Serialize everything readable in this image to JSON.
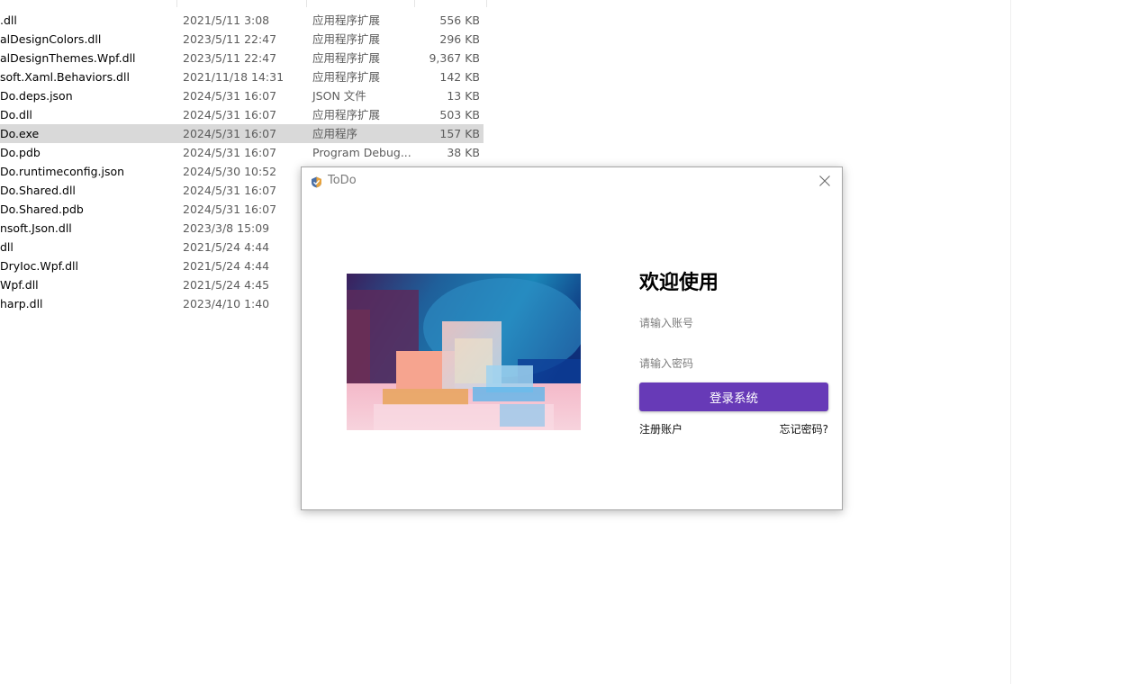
{
  "explorer": {
    "files": [
      {
        "name": ".dll",
        "date": "2021/5/11 3:08",
        "type": "应用程序扩展",
        "size": "556 KB"
      },
      {
        "name": "alDesignColors.dll",
        "date": "2023/5/11 22:47",
        "type": "应用程序扩展",
        "size": "296 KB"
      },
      {
        "name": "alDesignThemes.Wpf.dll",
        "date": "2023/5/11 22:47",
        "type": "应用程序扩展",
        "size": "9,367 KB"
      },
      {
        "name": "soft.Xaml.Behaviors.dll",
        "date": "2021/11/18 14:31",
        "type": "应用程序扩展",
        "size": "142 KB"
      },
      {
        "name": "Do.deps.json",
        "date": "2024/5/31 16:07",
        "type": "JSON 文件",
        "size": "13 KB"
      },
      {
        "name": "Do.dll",
        "date": "2024/5/31 16:07",
        "type": "应用程序扩展",
        "size": "503 KB"
      },
      {
        "name": "Do.exe",
        "date": "2024/5/31 16:07",
        "type": "应用程序",
        "size": "157 KB",
        "selected": true
      },
      {
        "name": "Do.pdb",
        "date": "2024/5/31 16:07",
        "type": "Program Debug...",
        "size": "38 KB"
      },
      {
        "name": "Do.runtimeconfig.json",
        "date": "2024/5/30 10:52",
        "type": "",
        "size": ""
      },
      {
        "name": "Do.Shared.dll",
        "date": "2024/5/31 16:07",
        "type": "",
        "size": ""
      },
      {
        "name": "Do.Shared.pdb",
        "date": "2024/5/31 16:07",
        "type": "",
        "size": ""
      },
      {
        "name": "nsoft.Json.dll",
        "date": "2023/3/8 15:09",
        "type": "",
        "size": ""
      },
      {
        "name": "dll",
        "date": "2021/5/24 4:44",
        "type": "",
        "size": ""
      },
      {
        "name": "DryIoc.Wpf.dll",
        "date": "2021/5/24 4:44",
        "type": "",
        "size": ""
      },
      {
        "name": "Wpf.dll",
        "date": "2021/5/24 4:45",
        "type": "",
        "size": ""
      },
      {
        "name": "harp.dll",
        "date": "2023/4/10 1:40",
        "type": "",
        "size": ""
      }
    ]
  },
  "login_window": {
    "title": "ToDo",
    "app_icon": "todo-app-icon",
    "close_icon": "close-icon",
    "welcome": "欢迎使用",
    "account_placeholder": "请输入账号",
    "password_placeholder": "请输入密码",
    "login_button": "登录系统",
    "register_link": "注册账户",
    "forgot_link": "忘记密码?",
    "accent_color": "#673ab7"
  }
}
